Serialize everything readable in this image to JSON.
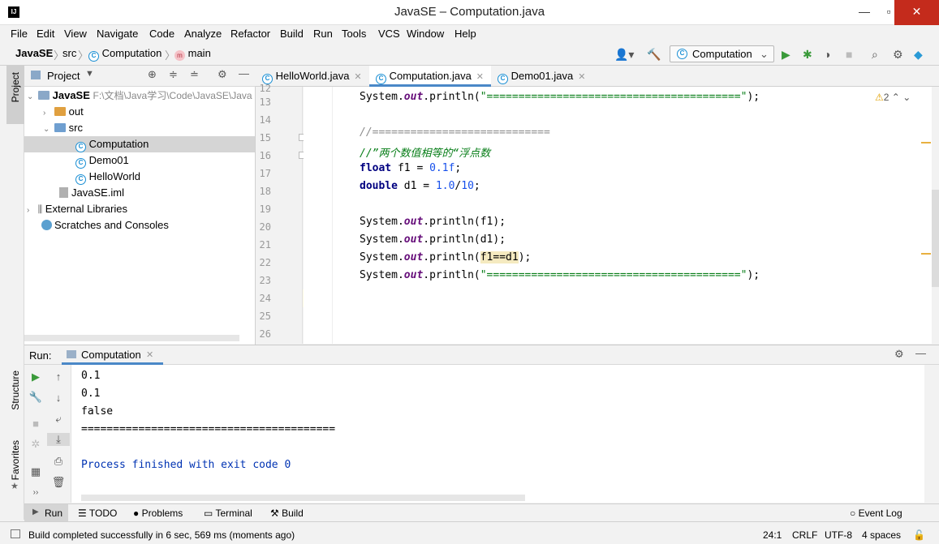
{
  "window": {
    "title": "JavaSE – Computation.java",
    "app_icon": "IJ"
  },
  "menu": [
    "File",
    "Edit",
    "View",
    "Navigate",
    "Code",
    "Analyze",
    "Refactor",
    "Build",
    "Run",
    "Tools",
    "VCS",
    "Window",
    "Help"
  ],
  "breadcrumb": {
    "project": "JavaSE",
    "folder": "src",
    "file": "Computation",
    "method": "main"
  },
  "run_config": {
    "label": "Computation"
  },
  "project_panel": {
    "title": "Project",
    "tree": [
      {
        "label": "JavaSE",
        "path": "F:\\文档\\Java学习\\Code\\JavaSE\\Java"
      },
      {
        "label": "out"
      },
      {
        "label": "src"
      },
      {
        "label": "Computation"
      },
      {
        "label": "Demo01"
      },
      {
        "label": "HelloWorld"
      },
      {
        "label": "JavaSE.iml"
      },
      {
        "label": "External Libraries"
      },
      {
        "label": "Scratches and Consoles"
      }
    ]
  },
  "editor": {
    "tabs": [
      {
        "label": "HelloWorld.java"
      },
      {
        "label": "Computation.java"
      },
      {
        "label": "Demo01.java"
      }
    ],
    "warnings": "2",
    "line_numbers": [
      "12",
      "13",
      "14",
      "15",
      "16",
      "17",
      "18",
      "19",
      "20",
      "21",
      "22",
      "23",
      "24",
      "25",
      "26"
    ],
    "lines": {
      "l13_str": "\"========================================\"",
      "l15": "//============================",
      "l16": "//”两个数值相等的“浮点数",
      "l17_var": " f1 = ",
      "l17_num": "0.1f",
      "l18_var": " d1 = ",
      "l18_num1": "1.0",
      "l18_num2": "10",
      "l20_arg": "(f1);",
      "l21_arg": "(d1);",
      "l22_hl": "f1==d1",
      "l23_str": "\"========================================\""
    },
    "tokens": {
      "system": "System.",
      "out": "out",
      "println": ".println",
      "float": "float",
      "double": "double"
    }
  },
  "run_panel": {
    "label": "Run:",
    "tab": "Computation",
    "output": [
      "0.1",
      "0.1",
      "false",
      "========================================",
      "",
      "Process finished with exit code 0"
    ]
  },
  "bottom_tabs": [
    "Run",
    "TODO",
    "Problems",
    "Terminal",
    "Build"
  ],
  "event_log": "Event Log",
  "left_stripe": [
    "Project",
    "Structure",
    "Favorites"
  ],
  "status": {
    "message": "Build completed successfully in 6 sec, 569 ms (moments ago)",
    "position": "24:1",
    "line_sep": "CRLF",
    "encoding": "UTF-8",
    "indent": "4 spaces"
  },
  "colors": {
    "keyword": "#000080",
    "string": "#067d17",
    "number": "#1750eb",
    "field": "#660e7a",
    "accent": "#4a88c7"
  }
}
